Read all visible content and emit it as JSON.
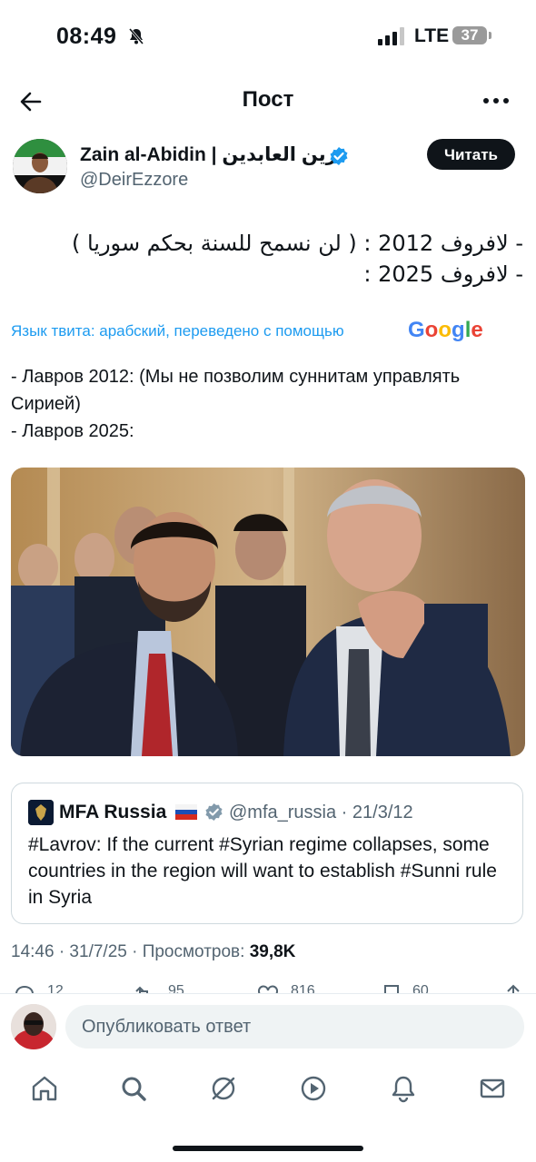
{
  "status_bar": {
    "time": "08:49",
    "network": "LTE",
    "battery": "37"
  },
  "header": {
    "title": "Пост"
  },
  "author": {
    "name": "Zain al-Abidin | زين العابدين",
    "handle": "@DeirEzzore",
    "follow_label": "Читать"
  },
  "tweet": {
    "arabic_lines": [
      "- لافروف 2012 : ( لن نسمح للسنة بحكم سوريا )",
      "- لافروف 2025 :"
    ],
    "translation_note": "Язык твита: арабский, переведено с помощью",
    "translation_brand": "Google",
    "translated_text": "- Лавров 2012: (Мы не позволим суннитам управлять Сирией)\n- Лавров 2025:"
  },
  "quote": {
    "name": "MFA Russia",
    "handle_date": "@mfa_russia · 21/3/12",
    "text": "#Lavrov: If the current #Syrian regime collapses, some countries in the region will want to establish #Sunni rule in Syria"
  },
  "meta": {
    "time_date": "14:46 · 31/7/25 · Просмотров:",
    "views": "39,8K"
  },
  "actions": {
    "replies": "12",
    "reposts": "95",
    "likes": "816",
    "bookmarks": "60"
  },
  "reply": {
    "placeholder": "Опубликовать ответ"
  },
  "colors": {
    "accent": "#1d9bf0",
    "text": "#0f1419",
    "secondary": "#536471"
  }
}
